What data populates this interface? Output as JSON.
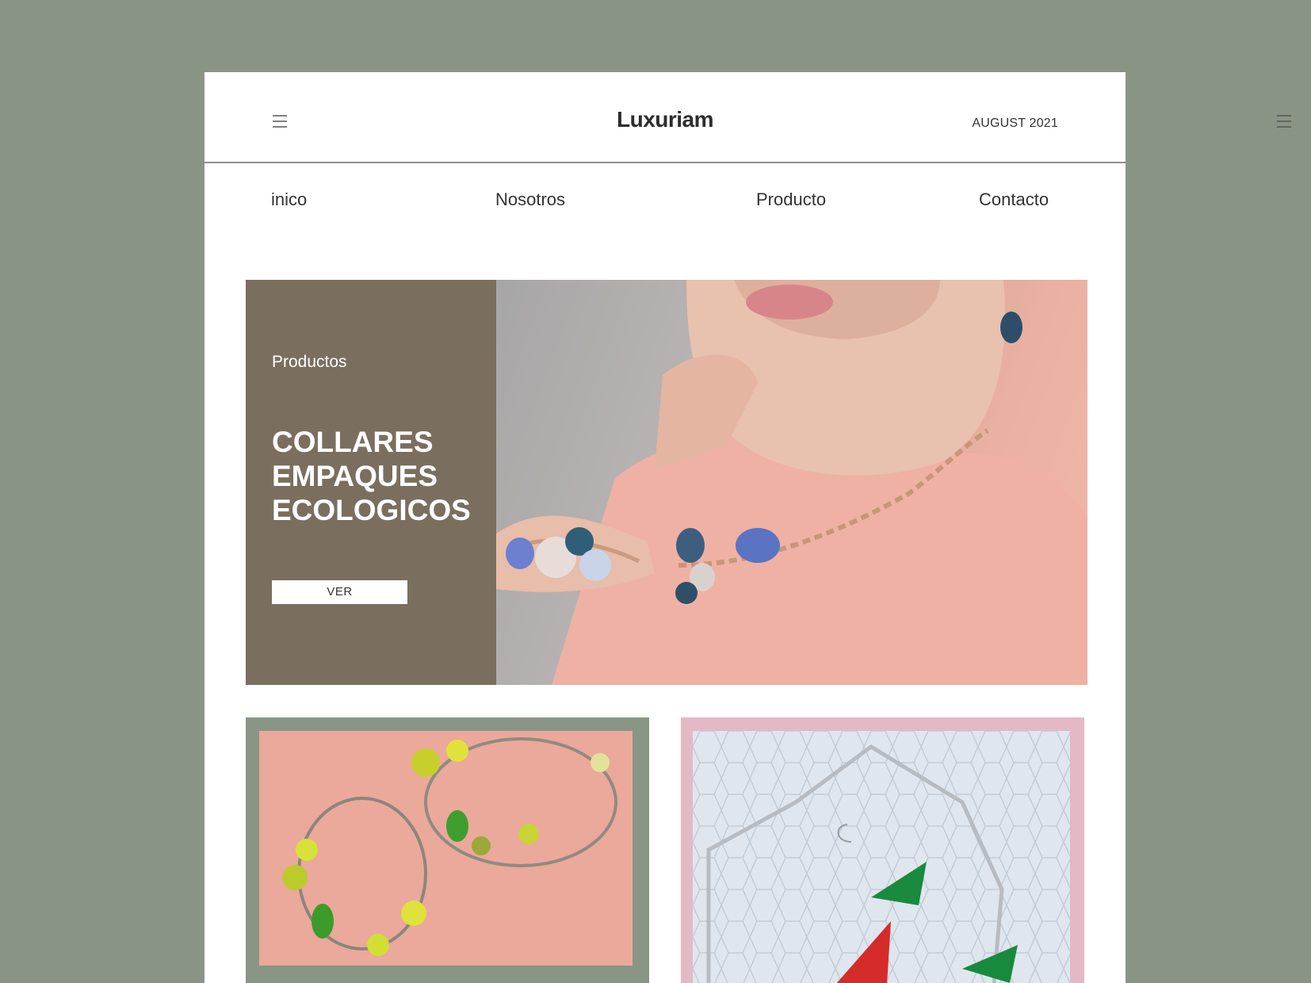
{
  "header": {
    "brand": "Luxuriam",
    "date": "AUGUST 2021",
    "menu_icon": "hamburger-menu-icon"
  },
  "nav": {
    "items": [
      "inico",
      "Nosotros",
      "Producto",
      "Contacto"
    ]
  },
  "hero": {
    "eyebrow": "Productos",
    "title_lines": [
      "COLLARES",
      "EMPAQUES",
      "ECOLOGICOS"
    ],
    "button_label": "VER",
    "image_description": "jewelry-model-photo"
  },
  "cards": [
    {
      "image": "green-bead-bracelets-photo"
    },
    {
      "image": "beaded-earrings-necklace-photo"
    }
  ],
  "colors": {
    "background": "#8a9485",
    "hero_panel": "#7a6e5f",
    "card_green": "#8a9685",
    "card_pink": "#e5b8c5"
  }
}
